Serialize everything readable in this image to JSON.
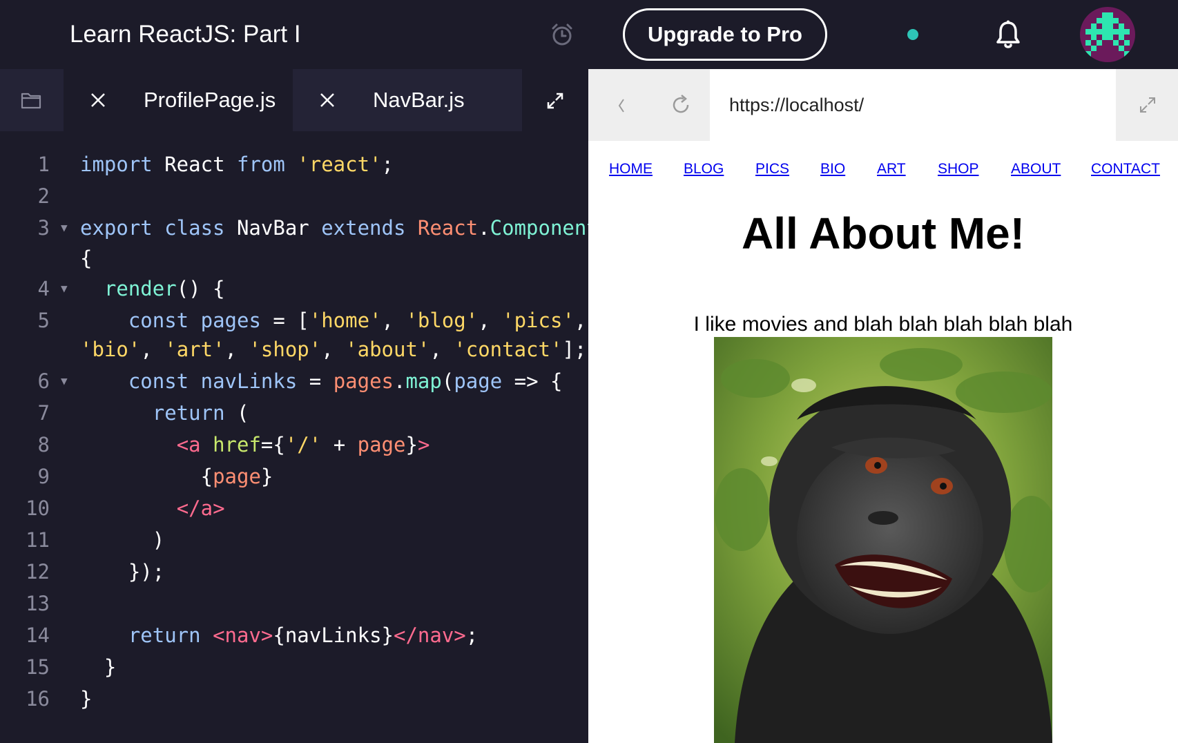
{
  "app": {
    "course_title": "Learn ReactJS: Part I",
    "upgrade_label": "Upgrade to Pro",
    "icons": {
      "alarm": "alarm-clock-icon",
      "status": "status-dot",
      "notifications": "bell-icon",
      "avatar": "pixel-invader-avatar"
    },
    "colors": {
      "background": "#1c1b29",
      "status_dot": "#2ec4b6",
      "avatar_bg": "#6b1a5b",
      "avatar_pixels": "#2ee6b0"
    }
  },
  "editor": {
    "tabs": [
      {
        "label": "ProfilePage.js",
        "active": false
      },
      {
        "label": "NavBar.js",
        "active": true
      }
    ],
    "code": {
      "l1": "1",
      "l2": "2",
      "l3": "3",
      "l4": "4",
      "l5": "5",
      "l6": "6",
      "l7": "7",
      "l8": "8",
      "l9": "9",
      "l10": "10",
      "l11": "11",
      "l12": "12",
      "l13": "13",
      "l14": "14",
      "l15": "15",
      "l16": "16",
      "t1a": "import",
      "t1b": " React ",
      "t1c": "from",
      "t1d": "'react'",
      "t1e": ";",
      "t3a": "export class",
      "t3b": " NavBar ",
      "t3c": "extends",
      "t3d": "React",
      "t3e": ".",
      "t3f": "Component",
      "t3g": "{",
      "t4a": "render",
      "t4b": "() {",
      "t5a": "const",
      "t5b": " pages ",
      "t5c": "= [",
      "t5d": "'home'",
      "t5e": ", ",
      "t5f": "'blog'",
      "t5g": ", ",
      "t5h": "'pics'",
      "t5i": ",",
      "t5j": "'bio'",
      "t5k": ", ",
      "t5l": "'art'",
      "t5m": ", ",
      "t5n": "'shop'",
      "t5o": ", ",
      "t5p": "'about'",
      "t5q": ", ",
      "t5r": "'contact'",
      "t5s": "];",
      "t6a": "const",
      "t6b": " navLinks ",
      "t6c": "= ",
      "t6d": "pages",
      "t6e": ".",
      "t6f": "map",
      "t6g": "(",
      "t6h": "page",
      "t6i": " => {",
      "t7a": "return",
      "t7b": " (",
      "t8a": "<a",
      "t8b": " href",
      "t8c": "={",
      "t8d": "'/'",
      "t8e": " + ",
      "t8f": "page",
      "t8g": "}",
      "t8h": ">",
      "t9a": "{",
      "t9b": "page",
      "t9c": "}",
      "t10a": "</a>",
      "t11a": ")",
      "t12a": "});",
      "t14a": "return",
      "t14b": " ",
      "t14c": "<nav>",
      "t14d": "{navLinks}",
      "t14e": "</nav>",
      "t14f": ";",
      "t15a": "}",
      "t16a": "}"
    },
    "colors": {
      "keyword": "#9fc5f8",
      "string": "#ffd866",
      "class": "#ff8f73",
      "function": "#7ff3d5",
      "tag": "#ff6b8f",
      "attribute": "#c8e86c"
    }
  },
  "browser": {
    "url": "https://localhost/",
    "nav_links": [
      "HOME",
      "BLOG",
      "PICS",
      "BIO",
      "ART",
      "SHOP",
      "ABOUT",
      "CONTACT"
    ],
    "heading": "All About Me!",
    "text": "I like movies and blah blah blah blah blah",
    "photo": "monkey-selfie-photo"
  }
}
